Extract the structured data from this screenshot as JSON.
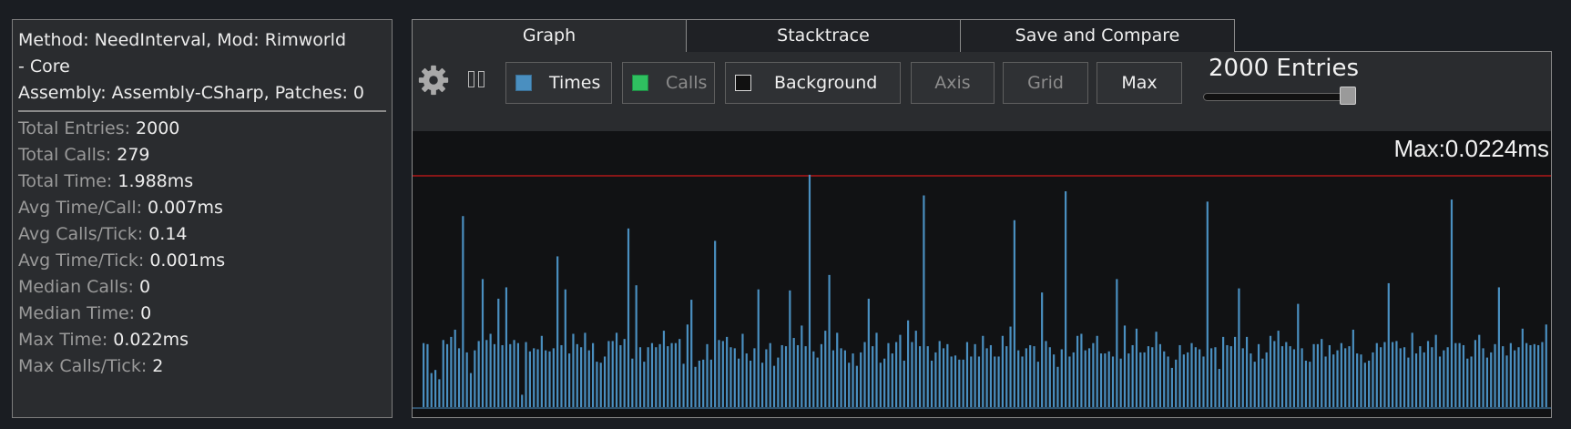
{
  "info": {
    "method_line1": "Method: NeedInterval, Mod: Rimworld",
    "method_line2": "- Core",
    "assembly_line": "Assembly: Assembly-CSharp, Patches: 0",
    "stats": [
      {
        "label": "Total Entries: ",
        "value": "2000"
      },
      {
        "label": "Total Calls: ",
        "value": "279"
      },
      {
        "label": "Total Time: ",
        "value": "1.988ms"
      },
      {
        "label": "Avg Time/Call: ",
        "value": "0.007ms"
      },
      {
        "label": "Avg Calls/Tick: ",
        "value": "0.14"
      },
      {
        "label": "Avg Time/Tick: ",
        "value": "0.001ms"
      },
      {
        "label": "Median Calls: ",
        "value": "0"
      },
      {
        "label": "Median Time: ",
        "value": "0"
      },
      {
        "label": "Max Time: ",
        "value": "0.022ms"
      },
      {
        "label": "Max Calls/Tick: ",
        "value": "2"
      }
    ]
  },
  "tabs": [
    {
      "label": "Graph",
      "active": true
    },
    {
      "label": "Stacktrace",
      "active": false
    },
    {
      "label": "Save and Compare",
      "active": false
    }
  ],
  "toolbar": {
    "settings_icon": "gear-icon",
    "pause_icon": "pause-icon",
    "times_label": "Times",
    "calls_label": "Calls",
    "background_label": "Background",
    "axis_label": "Axis",
    "grid_label": "Grid",
    "max_label": "Max",
    "entries_label": "2000 Entries",
    "entries_slider_fraction": 1.0
  },
  "colors": {
    "times": "#4a8fc0",
    "calls": "#2fc060",
    "max_line": "#b01818",
    "background": "#111214"
  },
  "chart_data": {
    "type": "bar",
    "title": "",
    "max_label": "Max:0.0224ms",
    "series": [
      {
        "name": "Times",
        "values": [
          0.0062,
          0.0061,
          0.0033,
          0.0036,
          0.0027,
          0.0065,
          0.0061,
          0.0068,
          0.0075,
          0.0057,
          0.0185,
          0.0053,
          0.0033,
          0.0055,
          0.0064,
          0.0124,
          0.0065,
          0.0071,
          0.0061,
          0.0105,
          0.006,
          0.0116,
          0.0061,
          0.0065,
          0.0062,
          0.0012,
          0.0063,
          0.0054,
          0.0057,
          0.0056,
          0.0069,
          0.0055,
          0.0054,
          0.0057,
          0.0146,
          0.006,
          0.0114,
          0.0052,
          0.0071,
          0.0061,
          0.0058,
          0.0072,
          0.0055,
          0.0062,
          0.0044,
          0.0043,
          0.0049,
          0.0064,
          0.0064,
          0.0072,
          0.006,
          0.0066,
          0.0173,
          0.0047,
          0.0118,
          0.0058,
          0.0044,
          0.0058,
          0.0062,
          0.0058,
          0.0061,
          0.0074,
          0.0059,
          0.0062,
          0.0062,
          0.0066,
          0.0042,
          0.008,
          0.0104,
          0.0039,
          0.0045,
          0.0046,
          0.0061,
          0.0046,
          0.0161,
          0.0065,
          0.0064,
          0.0068,
          0.0058,
          0.0057,
          0.0047,
          0.0071,
          0.0052,
          0.0045,
          0.0057,
          0.0114,
          0.0043,
          0.0056,
          0.0062,
          0.004,
          0.0048,
          0.006,
          0.0059,
          0.0113,
          0.0067,
          0.006,
          0.0079,
          0.0059,
          0.0225,
          0.0054,
          0.0048,
          0.0061,
          0.0074,
          0.0128,
          0.0055,
          0.0072,
          0.0057,
          0.0055,
          0.0043,
          0.0052,
          0.004,
          0.0053,
          0.0063,
          0.0105,
          0.0059,
          0.0072,
          0.0043,
          0.0047,
          0.0062,
          0.0052,
          0.0063,
          0.007,
          0.0045,
          0.0084,
          0.0063,
          0.0074,
          0.0059,
          0.0205,
          0.0059,
          0.0045,
          0.0053,
          0.0064,
          0.0057,
          0.0061,
          0.0049,
          0.005,
          0.0046,
          0.0046,
          0.0063,
          0.0049,
          0.0061,
          0.0049,
          0.0069,
          0.0057,
          0.006,
          0.0049,
          0.0049,
          0.0069,
          0.0059,
          0.0078,
          0.0181,
          0.0055,
          0.0049,
          0.0057,
          0.006,
          0.0059,
          0.0044,
          0.0111,
          0.0064,
          0.0058,
          0.0051,
          0.0039,
          0.0056,
          0.0209,
          0.0049,
          0.0053,
          0.0069,
          0.0071,
          0.0055,
          0.0057,
          0.0062,
          0.0069,
          0.0052,
          0.0052,
          0.0054,
          0.0049,
          0.0124,
          0.0047,
          0.0079,
          0.0052,
          0.006,
          0.0076,
          0.0053,
          0.0053,
          0.0059,
          0.0058,
          0.0073,
          0.0061,
          0.0054,
          0.0049,
          0.0038,
          0.0046,
          0.006,
          0.0051,
          0.0053,
          0.0062,
          0.0058,
          0.0056,
          0.0049,
          0.0199,
          0.0057,
          0.0058,
          0.0037,
          0.0068,
          0.006,
          0.0059,
          0.0068,
          0.0115,
          0.0057,
          0.0068,
          0.0052,
          0.0044,
          0.0061,
          0.0047,
          0.0053,
          0.0069,
          0.0064,
          0.0074,
          0.0059,
          0.0063,
          0.0059,
          0.0056,
          0.01,
          0.0057,
          0.0045,
          0.0044,
          0.0061,
          0.0061,
          0.0066,
          0.0049,
          0.006,
          0.0051,
          0.0055,
          0.0062,
          0.0057,
          0.0059,
          0.0075,
          0.0052,
          0.0051,
          0.0043,
          0.0045,
          0.0053,
          0.0062,
          0.0058,
          0.0063,
          0.012,
          0.0063,
          0.0064,
          0.0057,
          0.0058,
          0.0048,
          0.0072,
          0.0052,
          0.0059,
          0.0053,
          0.0064,
          0.0058,
          0.007,
          0.0049,
          0.0055,
          0.0058,
          0.0201,
          0.0062,
          0.0062,
          0.006,
          0.0047,
          0.0049,
          0.0065,
          0.007,
          0.0057,
          0.0048,
          0.0053,
          0.0061,
          0.0116,
          0.0059,
          0.005,
          0.0062,
          0.0055,
          0.0058,
          0.0076,
          0.0062,
          0.006,
          0.0061,
          0.006,
          0.0063,
          0.008
        ]
      }
    ],
    "ylim": [
      0,
      0.0224
    ],
    "legend": "toolbar",
    "grid": false
  }
}
